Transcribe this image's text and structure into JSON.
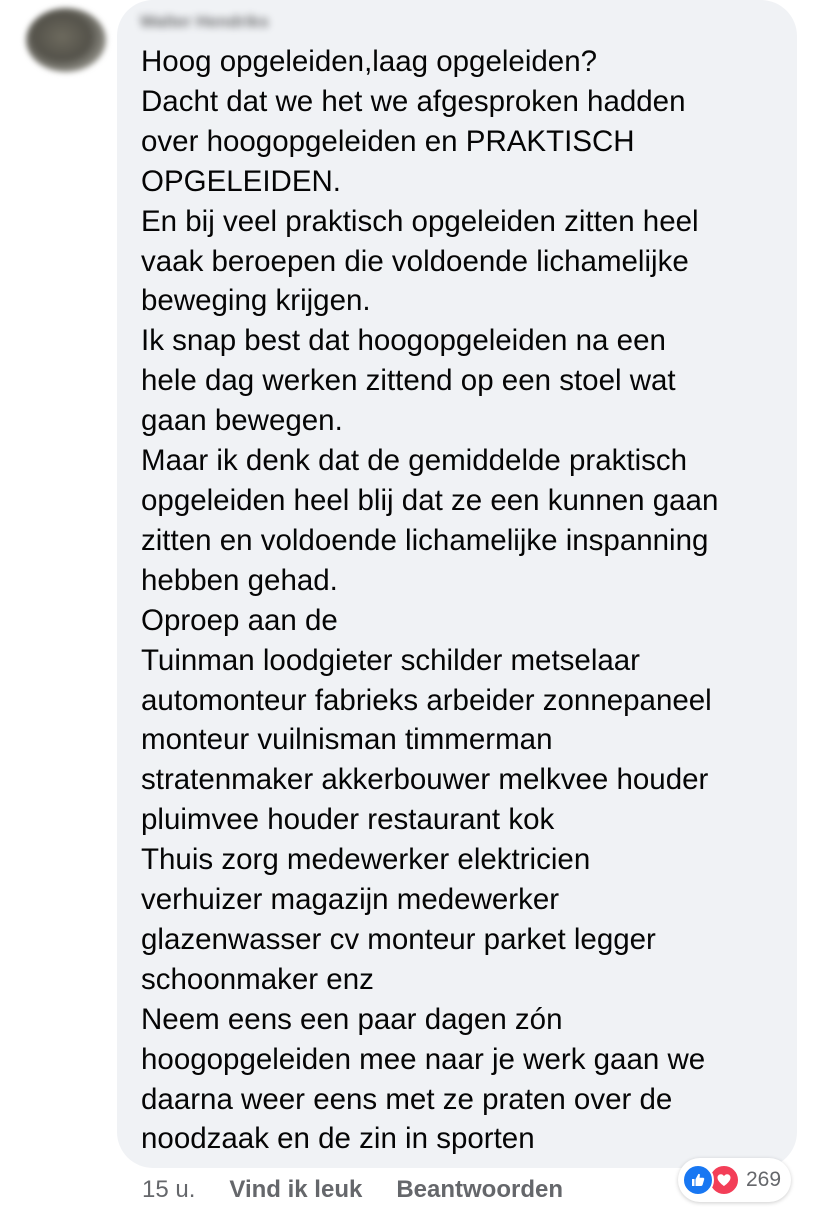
{
  "comment": {
    "author": "Walter Hendriks",
    "body": "Hoog opgeleiden,laag opgeleiden?\nDacht dat we het we afgesproken hadden\nover hoogopgeleiden en PRAKTISCH\nOPGELEIDEN.\nEn bij veel praktisch opgeleiden zitten heel\nvaak beroepen die voldoende lichamelijke\nbeweging krijgen.\nIk snap best dat hoogopgeleiden na een\nhele dag werken zittend op een stoel wat\ngaan bewegen.\nMaar ik denk dat de gemiddelde praktisch\nopgeleiden heel blij dat ze een kunnen gaan\nzitten en voldoende lichamelijke inspanning\nhebben gehad.\nOproep aan de\nTuinman loodgieter schilder metselaar\nautomonteur fabrieks arbeider zonnepaneel\nmonteur vuilnisman timmerman\nstratenmaker akkerbouwer melkvee houder\npluimvee houder restaurant kok\nThuis zorg medewerker elektricien\nverhuizer magazijn medewerker\nglazenwasser cv monteur parket legger\nschoonmaker enz\nNeem eens een paar dagen zón\nhoogopgeleiden mee naar je werk gaan we\ndaarna weer eens met ze praten over de\nnoodzaak en de zin in sporten"
  },
  "footer": {
    "time": "15 u.",
    "like_label": "Vind ik leuk",
    "reply_label": "Beantwoorden"
  },
  "reactions": {
    "icons": [
      "like-icon",
      "love-icon"
    ],
    "count": "269",
    "like_color": "#1877f2",
    "love_color": "#f33e58"
  },
  "colors": {
    "bubble_bg": "#f0f2f5",
    "text": "#050505",
    "secondary_text": "#65676b"
  }
}
